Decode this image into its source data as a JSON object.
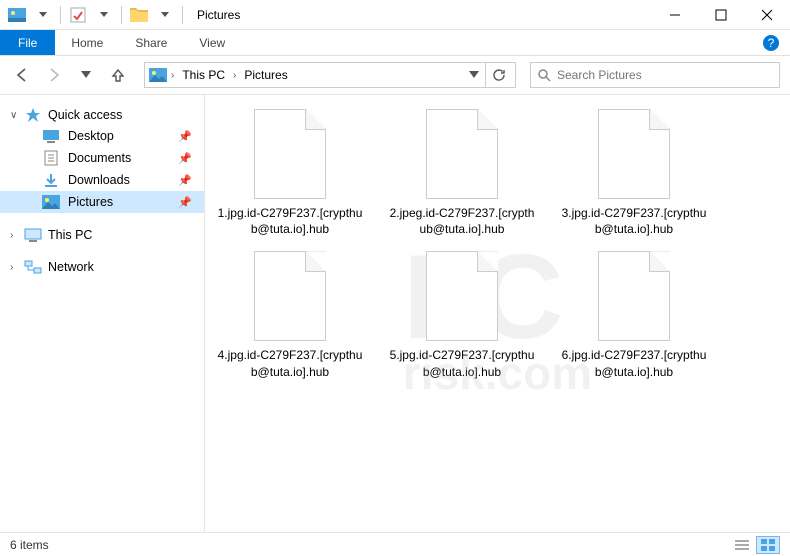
{
  "titlebar": {
    "title": "Pictures"
  },
  "ribbon": {
    "file": "File",
    "tabs": [
      "Home",
      "Share",
      "View"
    ]
  },
  "breadcrumb": {
    "segments": [
      "This PC",
      "Pictures"
    ]
  },
  "search": {
    "placeholder": "Search Pictures"
  },
  "sidebar": {
    "quick_access": {
      "label": "Quick access",
      "items": [
        {
          "label": "Desktop",
          "pinned": true,
          "icon": "desktop"
        },
        {
          "label": "Documents",
          "pinned": true,
          "icon": "documents"
        },
        {
          "label": "Downloads",
          "pinned": true,
          "icon": "downloads"
        },
        {
          "label": "Pictures",
          "pinned": true,
          "icon": "pictures",
          "selected": true
        }
      ]
    },
    "this_pc": {
      "label": "This PC"
    },
    "network": {
      "label": "Network"
    }
  },
  "files": [
    {
      "name": "1.jpg.id-C279F237.[crypthub@tuta.io].hub"
    },
    {
      "name": "2.jpeg.id-C279F237.[crypthub@tuta.io].hub"
    },
    {
      "name": "3.jpg.id-C279F237.[crypthub@tuta.io].hub"
    },
    {
      "name": "4.jpg.id-C279F237.[crypthub@tuta.io].hub"
    },
    {
      "name": "5.jpg.id-C279F237.[crypthub@tuta.io].hub"
    },
    {
      "name": "6.jpg.id-C279F237.[crypthub@tuta.io].hub"
    }
  ],
  "status": {
    "count_label": "6 items"
  },
  "watermark": {
    "main": "PC",
    "sub": "risk.com"
  }
}
